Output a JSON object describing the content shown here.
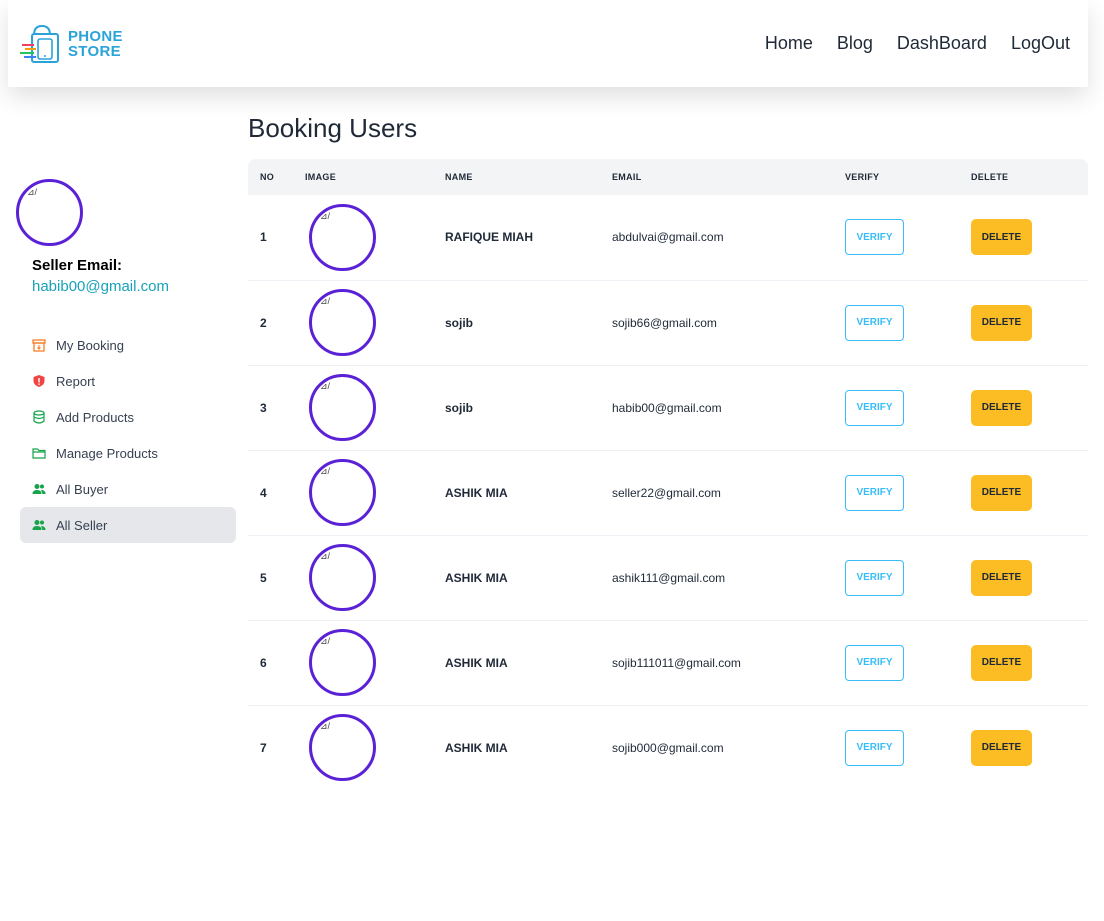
{
  "brand": {
    "line1": "PHONE",
    "line2": "STORE",
    "logo_icon": "shopping-bag-phone-icon"
  },
  "nav": [
    "Home",
    "Blog",
    "DashBoard",
    "LogOut"
  ],
  "sidebar": {
    "avatar_alt": "⊿/",
    "seller_label": "Seller Email:",
    "seller_email": "habib00@gmail.com",
    "items": [
      {
        "label": "My Booking",
        "icon": "archive-box-icon",
        "color": "#f97316"
      },
      {
        "label": "Report",
        "icon": "shield-alert-icon",
        "color": "#ef4444"
      },
      {
        "label": "Add Products",
        "icon": "database-icon",
        "color": "#16a34a"
      },
      {
        "label": "Manage Products",
        "icon": "folder-icon",
        "color": "#16a34a"
      },
      {
        "label": "All Buyer",
        "icon": "users-icon",
        "color": "#16a34a"
      },
      {
        "label": "All Seller",
        "icon": "users-icon",
        "color": "#16a34a",
        "active": true
      }
    ]
  },
  "main": {
    "title": "Booking Users",
    "columns": [
      "NO",
      "IMAGE",
      "NAME",
      "EMAIL",
      "VERIFY",
      "DELETE"
    ],
    "verify_label": "VERIFY",
    "delete_label": "DELETE",
    "image_alt": "⊿/",
    "rows": [
      {
        "no": "1",
        "name": "RAFIQUE MIAH",
        "email": "abdulvai@gmail.com"
      },
      {
        "no": "2",
        "name": "sojib",
        "email": "sojib66@gmail.com"
      },
      {
        "no": "3",
        "name": "sojib",
        "email": "habib00@gmail.com"
      },
      {
        "no": "4",
        "name": "ASHIK MIA",
        "email": "seller22@gmail.com"
      },
      {
        "no": "5",
        "name": "ASHIK MIA",
        "email": "ashik111@gmail.com"
      },
      {
        "no": "6",
        "name": "ASHIK MIA",
        "email": "sojib111011@gmail.com"
      },
      {
        "no": "7",
        "name": "ASHIK MIA",
        "email": "sojib000@gmail.com"
      }
    ]
  }
}
